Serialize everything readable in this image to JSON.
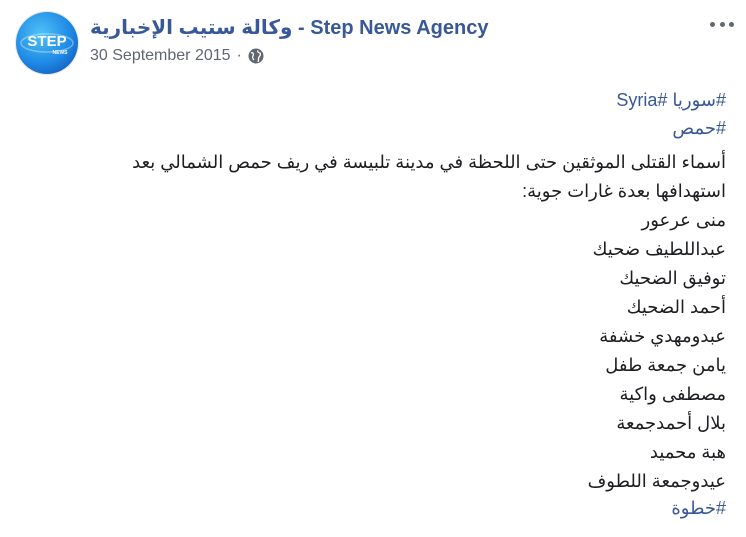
{
  "header": {
    "page_name": "وكالة ستيب الإخبارية - Step News Agency",
    "date": "30 September 2015",
    "separator": "·",
    "privacy_icon": "globe-icon",
    "more_icon": "more-horizontal-icon",
    "avatar_text": "STEP",
    "avatar_subtext": "NEWS"
  },
  "post": {
    "hashtags_top": [
      "#سوريا #Syria",
      "#حمص"
    ],
    "intro": "أسماء القتلى الموثقين حتى اللحظة في مدينة تلبيسة في ريف حمص الشمالي بعد استهدافها بعدة غارات جوية:",
    "names": [
      "منى عرعور",
      "عبداللطيف ضحيك",
      "توفيق الضحيك",
      "أحمد الضحيك",
      "عبدومهدي خشفة",
      "يامن جمعة طفل",
      "مصطفى واكية",
      "بلال أحمدجمعة",
      "هبة محميد",
      "عيدوجمعة اللطوف"
    ],
    "hashtag_bottom": "#خطوة"
  },
  "colors": {
    "link": "#385898",
    "text": "#1c1e21",
    "meta": "#606770",
    "avatar": "#1e88e5"
  }
}
